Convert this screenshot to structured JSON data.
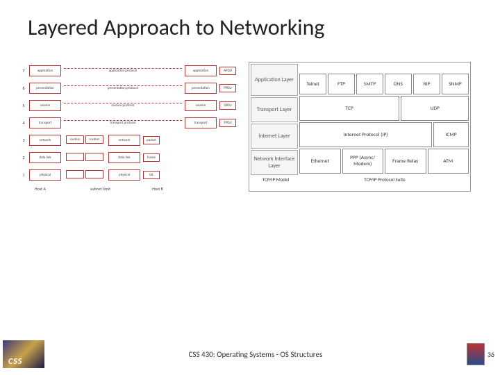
{
  "title": "Layered Approach to Networking",
  "osi": {
    "numbers": [
      "7",
      "6",
      "5",
      "4",
      "3",
      "2",
      "1"
    ],
    "layers": [
      "application",
      "presentation",
      "session",
      "transport",
      "network",
      "data link",
      "physical"
    ],
    "protocols": [
      "application protocol",
      "presentation protocol",
      "session protocol",
      "transport protocol",
      "",
      "",
      ""
    ],
    "pdus": [
      "APDU",
      "PPDU",
      "SPDU",
      "TPDU",
      "packet",
      "frame",
      "bit"
    ],
    "subnet_labels": [
      "routers",
      "routers"
    ],
    "footer": {
      "hostA": "Host A",
      "mid": "subnet limit",
      "hostB": "Host B"
    }
  },
  "tcpip": {
    "layers": [
      "Application Layer",
      "Transport Layer",
      "Internet Layer",
      "Network Interface Layer"
    ],
    "app_row": [
      "Telnet",
      "FTP",
      "SMTP",
      "DNS",
      "RIP",
      "SNMP"
    ],
    "transport_row": [
      "TCP",
      "UDP"
    ],
    "internet_row": [
      "Internet Protocol (IP)",
      "ICMP"
    ],
    "net_row": [
      "Ethernet",
      "PPP (Async/ Modem)",
      "Frame Relay",
      "ATM"
    ],
    "footer": {
      "model": "TCP/IP Model",
      "suite": "TCP/IP Protocol Suite"
    }
  },
  "footer": {
    "text": "CSS 430: Operating Systems - OS Structures",
    "page": "36"
  }
}
